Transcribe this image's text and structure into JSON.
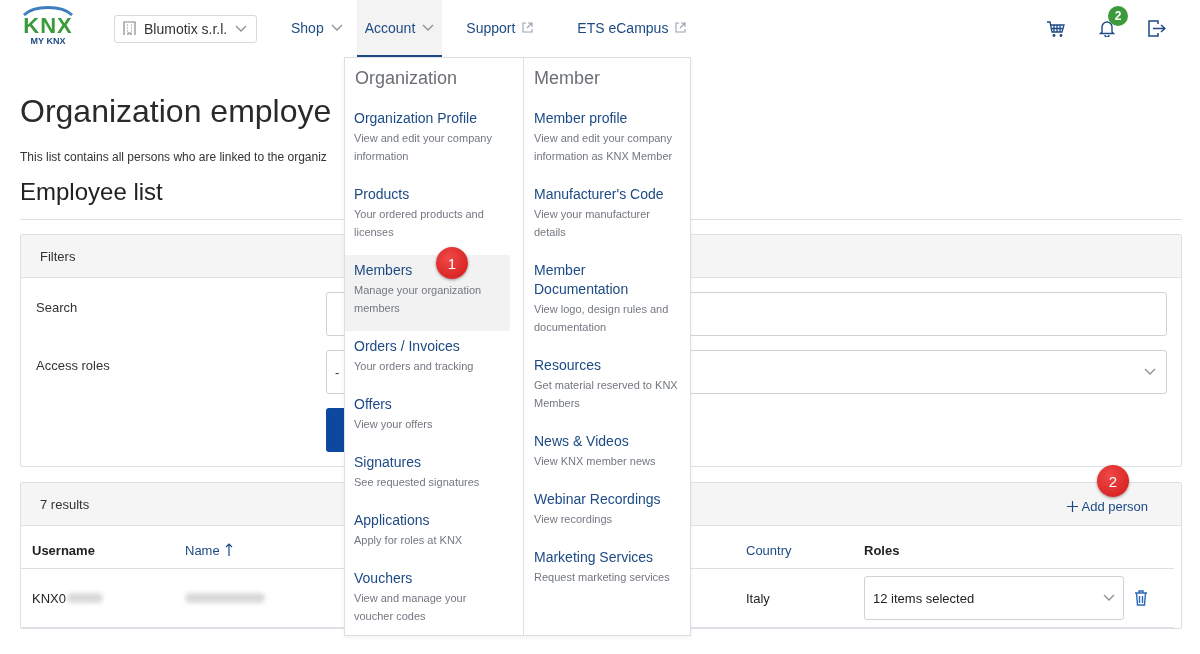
{
  "header": {
    "logo": {
      "mark": "KNX",
      "subtext": "MY KNX"
    },
    "organization": "Blumotix s.r.l.",
    "nav": [
      {
        "label": "Shop",
        "kind": "dropdown",
        "selected": false
      },
      {
        "label": "Account",
        "kind": "dropdown",
        "selected": true
      },
      {
        "label": "Support",
        "kind": "external",
        "selected": false
      },
      {
        "label": "ETS eCampus",
        "kind": "external",
        "selected": false
      }
    ],
    "notifications_count": "2"
  },
  "account_menu": {
    "columns": [
      {
        "heading": "Organization",
        "items": [
          {
            "title": "Organization Profile",
            "description": "View and edit your company information",
            "selected": false
          },
          {
            "title": "Products",
            "description": "Your ordered products and licenses",
            "selected": false
          },
          {
            "title": "Members",
            "description": "Manage your organization members",
            "selected": true,
            "annotation": "1"
          },
          {
            "title": "Orders / Invoices",
            "description": "Your orders and tracking",
            "selected": false
          },
          {
            "title": "Offers",
            "description": "View your offers",
            "selected": false
          },
          {
            "title": "Signatures",
            "description": "See requested signatures",
            "selected": false
          },
          {
            "title": "Applications",
            "description": "Apply for roles at KNX",
            "selected": false
          },
          {
            "title": "Vouchers",
            "description": "View and manage your voucher codes",
            "selected": false
          }
        ]
      },
      {
        "heading": "Member",
        "items": [
          {
            "title": "Member profile",
            "description": "View and edit your company information as KNX Member",
            "selected": false
          },
          {
            "title": "Manufacturer's Code",
            "description": "View your manufacturer details",
            "selected": false
          },
          {
            "title": "Member Documentation",
            "description": "View logo, design rules and documentation",
            "selected": false
          },
          {
            "title": "Resources",
            "description": "Get material reserved to KNX Members",
            "selected": false
          },
          {
            "title": "News & Videos",
            "description": "View KNX member news",
            "selected": false
          },
          {
            "title": "Webinar Recordings",
            "description": "View recordings",
            "selected": false
          },
          {
            "title": "Marketing Services",
            "description": "Request marketing services",
            "selected": false
          }
        ]
      }
    ]
  },
  "page": {
    "title": "Organization employe",
    "intro": "This list contains all persons who are linked to the organiz",
    "section_title": "Employee list",
    "filters": {
      "title": "Filters",
      "search_label": "Search",
      "access_roles_label": "Access roles",
      "access_roles_value": "-"
    },
    "results": {
      "count": "7 results",
      "add_button": "Add person",
      "annotation": "2",
      "columns": [
        {
          "label": "Username",
          "sortable": false
        },
        {
          "label": "Name",
          "sortable": true,
          "sorted_ascending": true
        },
        {
          "label": "Country",
          "sortable": true
        },
        {
          "label": "Roles",
          "sortable": false
        }
      ],
      "rows": [
        {
          "username": "KNX0",
          "name_blurred": true,
          "country": "Italy",
          "roles": "12 items selected"
        }
      ]
    }
  }
}
